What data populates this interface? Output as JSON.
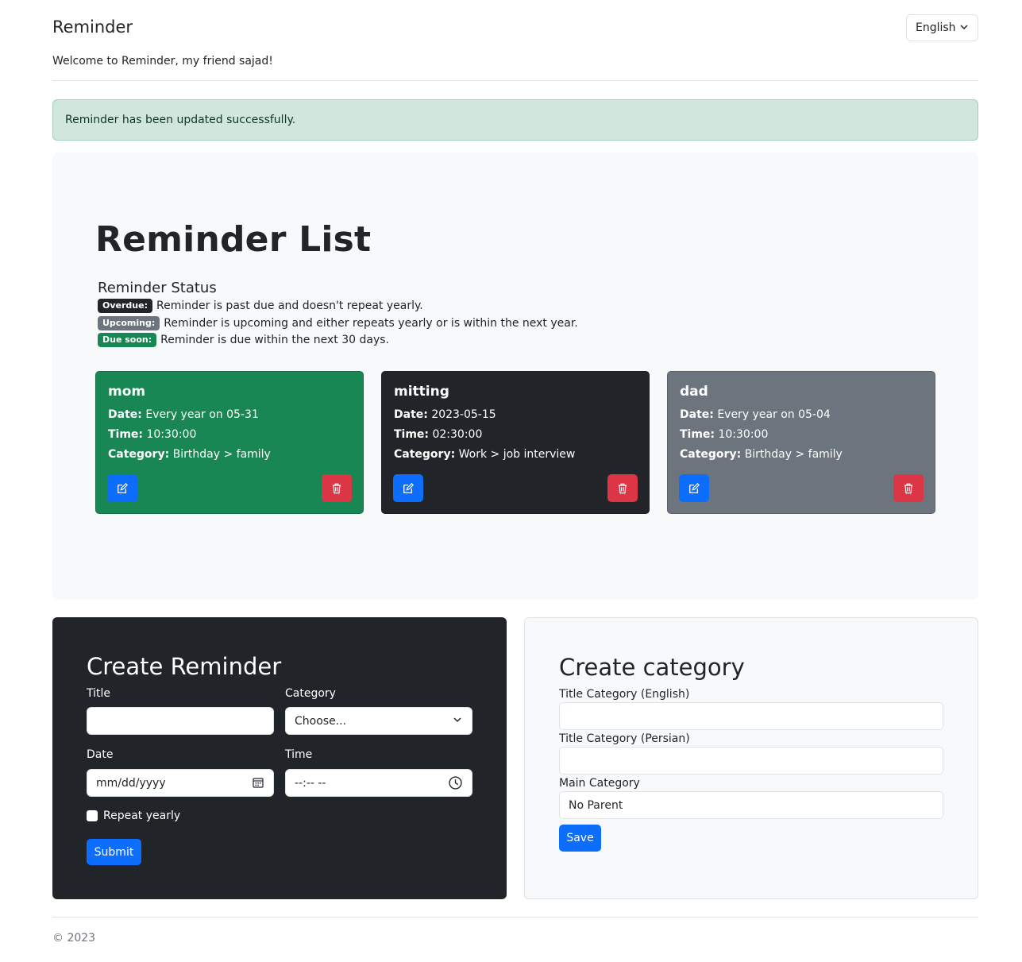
{
  "header": {
    "brand": "Reminder",
    "welcome": "Welcome to Reminder, my friend sajad!",
    "language": "English"
  },
  "alert": {
    "message": "Reminder has been updated successfully."
  },
  "reminder_list": {
    "title": "Reminder List",
    "status_heading": "Reminder Status",
    "statuses": [
      {
        "badge": "Overdue:",
        "text": "Reminder is past due and doesn't repeat yearly.",
        "color": "#212529"
      },
      {
        "badge": "Upcoming:",
        "text": "Reminder is upcoming and either repeats yearly or is within the next year.",
        "color": "#6c757d"
      },
      {
        "badge": "Due soon:",
        "text": "Reminder is due within the next 30 days.",
        "color": "#198754"
      }
    ],
    "labels": {
      "date": "Date:",
      "time": "Time:",
      "category": "Category:"
    },
    "cards": [
      {
        "title": "mom",
        "date": "Every year on 05-31",
        "time": "10:30:00",
        "category": "Birthday > family",
        "color": "#198754"
      },
      {
        "title": "mitting",
        "date": "2023-05-15",
        "time": "02:30:00",
        "category": "Work > job interview",
        "color": "#212529"
      },
      {
        "title": "dad",
        "date": "Every year on 05-04",
        "time": "10:30:00",
        "category": "Birthday > family",
        "color": "#6c757d"
      }
    ]
  },
  "create_reminder": {
    "heading": "Create Reminder",
    "title_label": "Title",
    "title_value": "",
    "category_label": "Category",
    "category_value": "Choose...",
    "date_label": "Date",
    "date_placeholder": "mm/dd/yyyy",
    "time_label": "Time",
    "time_placeholder": "--:-- --",
    "repeat_label": "Repeat yearly",
    "submit": "Submit"
  },
  "create_category": {
    "heading": "Create category",
    "title_en_label": "Title Category (English)",
    "title_en_value": "",
    "title_fa_label": "Title Category (Persian)",
    "title_fa_value": "",
    "main_label": "Main Category",
    "main_value": "No Parent",
    "save": "Save"
  },
  "footer": {
    "text": "© 2023"
  },
  "colors": {
    "primary": "#0d6efd",
    "danger": "#dc3545",
    "success": "#198754",
    "dark": "#212529",
    "secondary": "#6c757d"
  }
}
